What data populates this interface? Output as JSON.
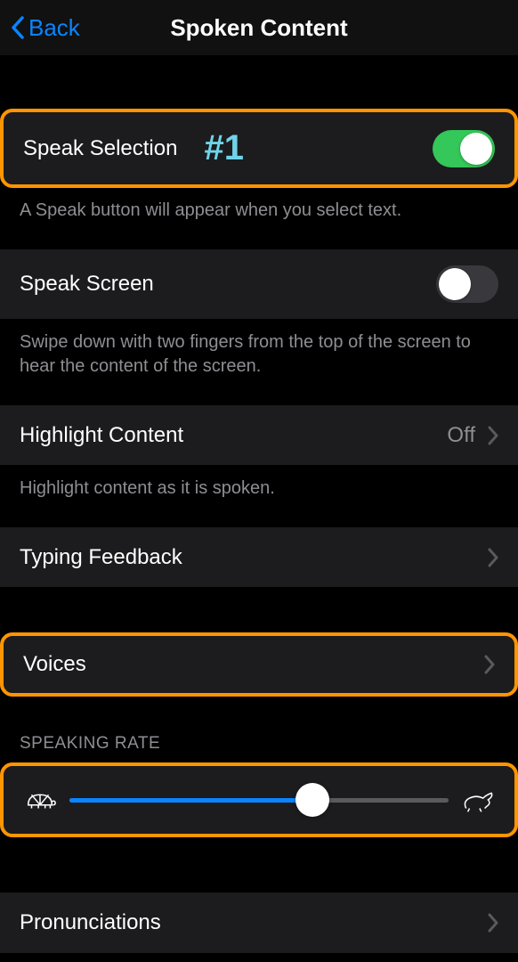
{
  "navbar": {
    "back": "Back",
    "title": "Spoken Content"
  },
  "annotation": "#1",
  "speakSelection": {
    "label": "Speak Selection",
    "footer": "A Speak button will appear when you select text."
  },
  "speakScreen": {
    "label": "Speak Screen",
    "footer": "Swipe down with two fingers from the top of the screen to hear the content of the screen."
  },
  "highlight": {
    "label": "Highlight Content",
    "value": "Off",
    "footer": "Highlight content as it is spoken."
  },
  "typingFeedback": {
    "label": "Typing Feedback"
  },
  "voices": {
    "label": "Voices"
  },
  "speakingRate": {
    "header": "SPEAKING RATE",
    "value": 0.64
  },
  "pronunciations": {
    "label": "Pronunciations"
  }
}
